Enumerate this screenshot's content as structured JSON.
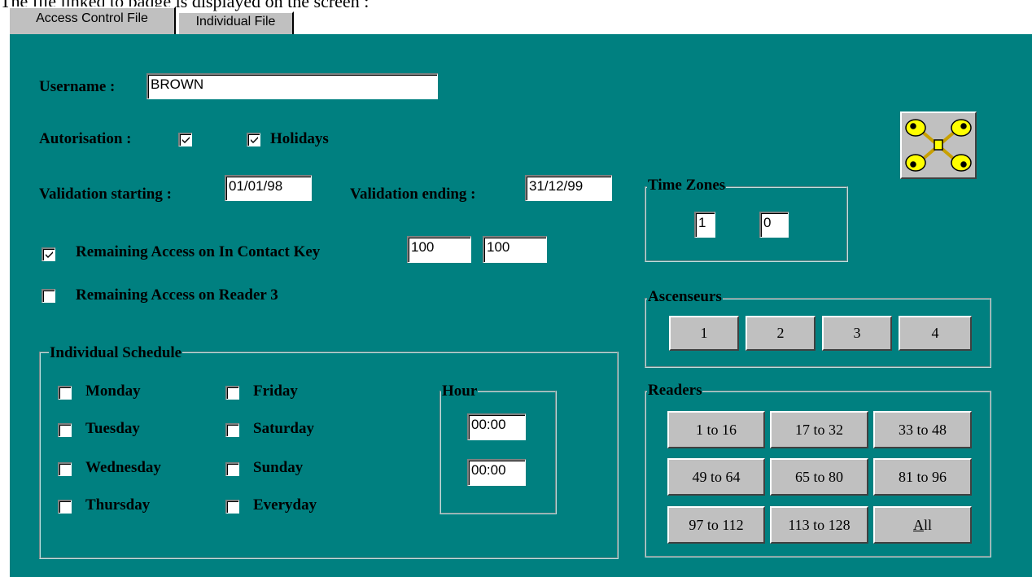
{
  "caption": "The file linked to badge is displayed on the screen :",
  "tabs": [
    {
      "label": "Access Control File",
      "active": true
    },
    {
      "label": "Individual File",
      "active": false
    }
  ],
  "form": {
    "username_label": "Username :",
    "username_value": "BROWN",
    "autorisation_label": "Autorisation :",
    "autorisation_checked": true,
    "holidays_label": "Holidays",
    "holidays_checked": true,
    "validation_start_label": "Validation starting :",
    "validation_start_value": "01/01/98",
    "validation_end_label": "Validation ending :",
    "validation_end_value": "31/12/99",
    "remaining_contact_label": "Remaining Access on In Contact Key",
    "remaining_contact_checked": true,
    "remaining_contact_value1": "100",
    "remaining_contact_value2": "100",
    "remaining_reader_label": "Remaining Access on Reader 3",
    "remaining_reader_checked": false
  },
  "schedule": {
    "title": "Individual Schedule",
    "days": [
      "Monday",
      "Tuesday",
      "Wednesday",
      "Thursday",
      "Friday",
      "Saturday",
      "Sunday",
      "Everyday"
    ],
    "hour_title": "Hour",
    "hour_start": "00:00",
    "hour_end": "00:00"
  },
  "time_zones": {
    "title": "Time Zones",
    "zone1": "1",
    "zone2": "0"
  },
  "ascenseurs": {
    "title": "Ascenseurs",
    "buttons": [
      "1",
      "2",
      "3",
      "4"
    ]
  },
  "readers": {
    "title": "Readers",
    "buttons": [
      "1 to 16",
      "17 to 32",
      "33 to 48",
      "49 to 64",
      "65 to 80",
      "81 to 96",
      "97 to 112",
      "113 to 128"
    ],
    "all_accel": "A",
    "all_rest": "ll"
  },
  "icons": {
    "keys": "keys-icon",
    "checkmark": "checkmark-icon"
  },
  "colors": {
    "panel": "#008080",
    "button_face": "#c0c0c0",
    "key_yellow": "#ffff00"
  }
}
